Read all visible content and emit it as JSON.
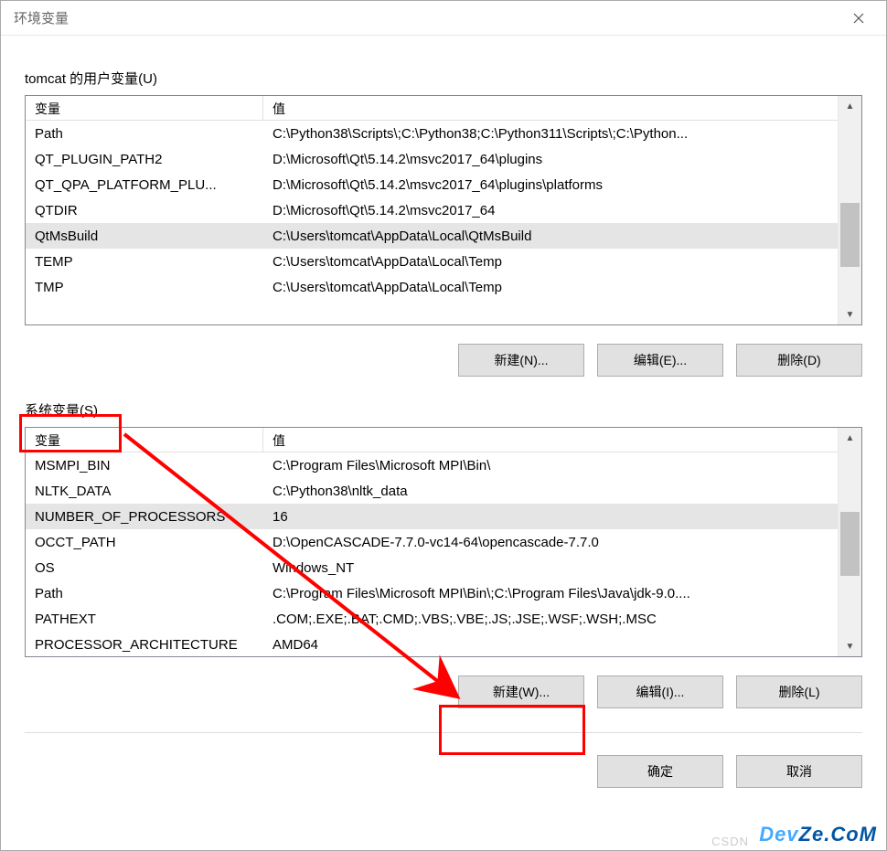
{
  "window": {
    "title": "环境变量"
  },
  "userVars": {
    "sectionLabel": "tomcat 的用户变量(U)",
    "headers": {
      "name": "变量",
      "value": "值"
    },
    "rows": [
      {
        "name": "Path",
        "value": "C:\\Python38\\Scripts\\;C:\\Python38;C:\\Python311\\Scripts\\;C:\\Python..."
      },
      {
        "name": "QT_PLUGIN_PATH2",
        "value": "D:\\Microsoft\\Qt\\5.14.2\\msvc2017_64\\plugins"
      },
      {
        "name": "QT_QPA_PLATFORM_PLU...",
        "value": "D:\\Microsoft\\Qt\\5.14.2\\msvc2017_64\\plugins\\platforms"
      },
      {
        "name": "QTDIR",
        "value": "D:\\Microsoft\\Qt\\5.14.2\\msvc2017_64"
      },
      {
        "name": "QtMsBuild",
        "value": "C:\\Users\\tomcat\\AppData\\Local\\QtMsBuild",
        "selected": true
      },
      {
        "name": "TEMP",
        "value": "C:\\Users\\tomcat\\AppData\\Local\\Temp"
      },
      {
        "name": "TMP",
        "value": "C:\\Users\\tomcat\\AppData\\Local\\Temp"
      }
    ],
    "buttons": {
      "new": "新建(N)...",
      "edit": "编辑(E)...",
      "delete": "删除(D)"
    }
  },
  "sysVars": {
    "sectionLabel": "系统变量(S)",
    "headers": {
      "name": "变量",
      "value": "值"
    },
    "rows": [
      {
        "name": "MSMPI_BIN",
        "value": "C:\\Program Files\\Microsoft MPI\\Bin\\"
      },
      {
        "name": "NLTK_DATA",
        "value": "C:\\Python38\\nltk_data"
      },
      {
        "name": "NUMBER_OF_PROCESSORS",
        "value": "16",
        "selected": true
      },
      {
        "name": "OCCT_PATH",
        "value": "D:\\OpenCASCADE-7.7.0-vc14-64\\opencascade-7.7.0"
      },
      {
        "name": "OS",
        "value": "Windows_NT"
      },
      {
        "name": "Path",
        "value": "C:\\Program Files\\Microsoft MPI\\Bin\\;C:\\Program Files\\Java\\jdk-9.0...."
      },
      {
        "name": "PATHEXT",
        "value": ".COM;.EXE;.BAT;.CMD;.VBS;.VBE;.JS;.JSE;.WSF;.WSH;.MSC"
      },
      {
        "name": "PROCESSOR_ARCHITECTURE",
        "value": "AMD64"
      }
    ],
    "buttons": {
      "new": "新建(W)...",
      "edit": "编辑(I)...",
      "delete": "删除(L)"
    }
  },
  "dialogButtons": {
    "ok": "确定",
    "cancel": "取消"
  },
  "watermark": {
    "csdn": "CSDN",
    "brand": "DevZe.CoM"
  }
}
